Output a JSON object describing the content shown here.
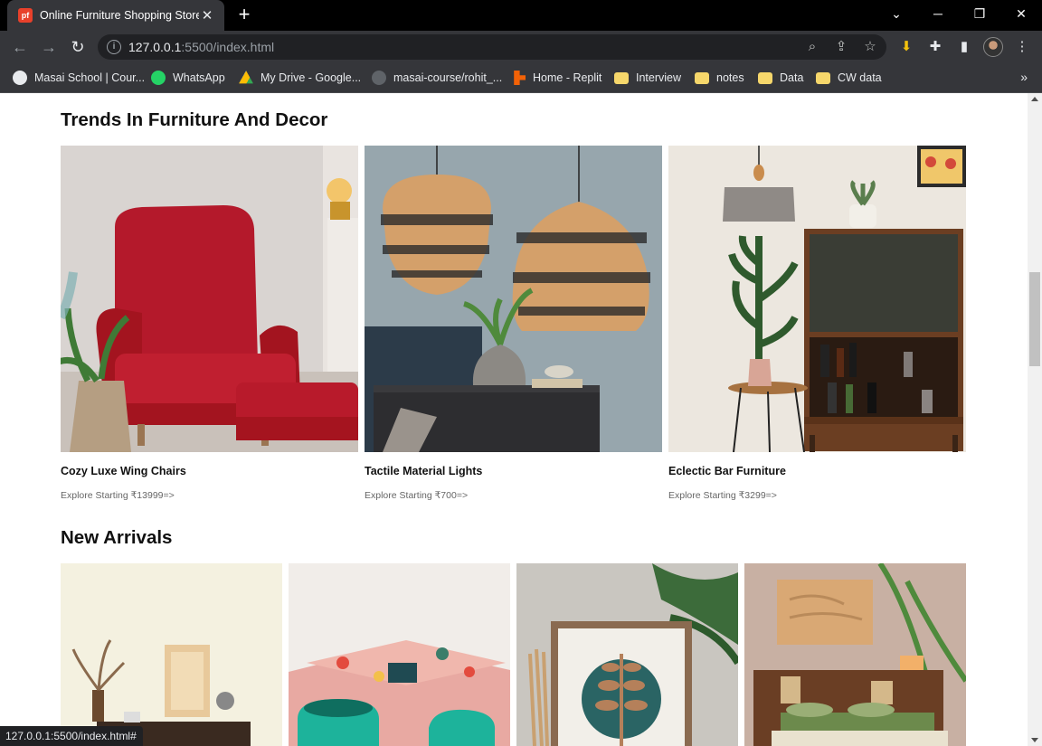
{
  "browser": {
    "tab_title": "Online Furniture Shopping Store",
    "tab_favicon_text": "pf",
    "url_host": "127.0.0.1",
    "url_rest": ":5500/index.html",
    "bookmarks": [
      {
        "label": "Masai School | Cour...",
        "icon": "globe-icon",
        "color": "#e8eaed"
      },
      {
        "label": "WhatsApp",
        "icon": "whatsapp-icon",
        "color": "#25d366"
      },
      {
        "label": "My Drive - Google...",
        "icon": "drive-icon",
        "color": "#fbbc04"
      },
      {
        "label": "masai-course/rohit_...",
        "icon": "github-icon",
        "color": "#5f6368"
      },
      {
        "label": "Home - Replit",
        "icon": "replit-icon",
        "color": "#f26207"
      },
      {
        "label": "Interview",
        "icon": "folder-icon",
        "color": "#f6d76b"
      },
      {
        "label": "notes",
        "icon": "folder-icon",
        "color": "#f6d76b"
      },
      {
        "label": "Data",
        "icon": "folder-icon",
        "color": "#f6d76b"
      },
      {
        "label": "CW data",
        "icon": "folder-icon",
        "color": "#f6d76b"
      }
    ]
  },
  "page": {
    "trends": {
      "title": "Trends In Furniture And Decor",
      "cards": [
        {
          "name": "Cozy Luxe Wing Chairs",
          "sub": "Explore Starting ₹13999=>",
          "image": "red-wing-chair"
        },
        {
          "name": "Tactile Material Lights",
          "sub": "Explore Starting ₹700=>",
          "image": "pendant-lights"
        },
        {
          "name": "Eclectic Bar Furniture",
          "sub": "Explore Starting ₹3299=>",
          "image": "bar-cabinet"
        }
      ]
    },
    "new_arrivals": {
      "title": "New Arrivals",
      "cards": [
        {
          "image": "decor-shelf"
        },
        {
          "image": "gift-box-mugs"
        },
        {
          "image": "leaf-wall-art"
        },
        {
          "image": "wooden-bed"
        }
      ]
    }
  },
  "status_bar": "127.0.0.1:5500/index.html#"
}
